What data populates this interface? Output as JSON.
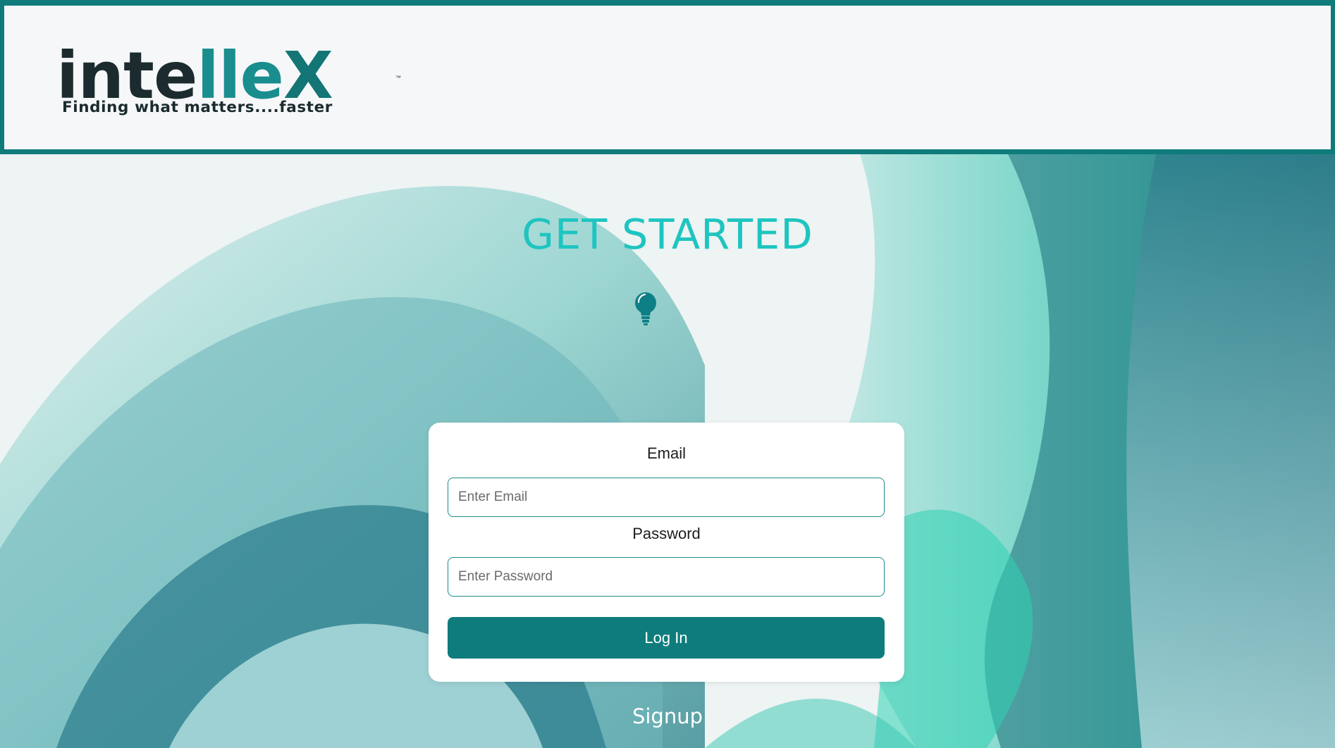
{
  "header": {
    "logo": {
      "word_dark": "inte",
      "word_accent": "lle",
      "word_end": "X",
      "tagline": "Finding what matters....faster",
      "tm": "™"
    }
  },
  "main": {
    "title": "GET STARTED",
    "icon": "lightbulb-icon"
  },
  "login_form": {
    "email_label": "Email",
    "email_placeholder": "Enter Email",
    "email_value": "",
    "password_label": "Password",
    "password_placeholder": "Enter Password",
    "password_value": "",
    "login_button": "Log In"
  },
  "signup_link": "Signup",
  "colors": {
    "brand_teal": "#0e7c7c",
    "title_teal": "#1ec5c0",
    "logo_dark": "#1b2b2e"
  }
}
